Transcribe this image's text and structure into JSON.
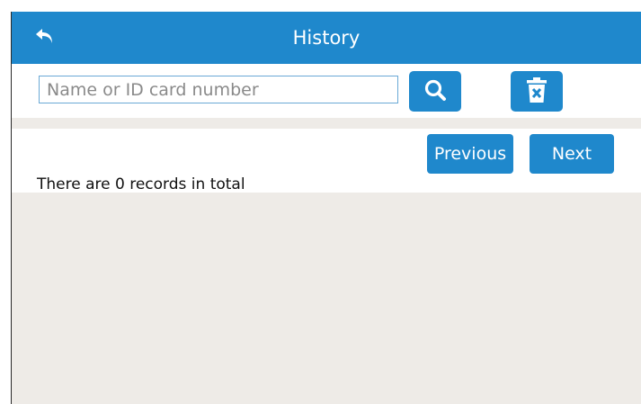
{
  "header": {
    "title": "History"
  },
  "search": {
    "placeholder": "Name or ID card number",
    "value": ""
  },
  "icons": {
    "back": "back-arrow-icon",
    "search": "magnifier-icon",
    "delete": "trash-x-icon"
  },
  "pagination": {
    "previous_label": "Previous",
    "next_label": "Next"
  },
  "records": {
    "prefix": "There are ",
    "count": "0",
    "suffix": " records in total"
  },
  "colors": {
    "accent": "#1f88cc",
    "background_gray": "#eeebe7",
    "text": "#111111"
  }
}
